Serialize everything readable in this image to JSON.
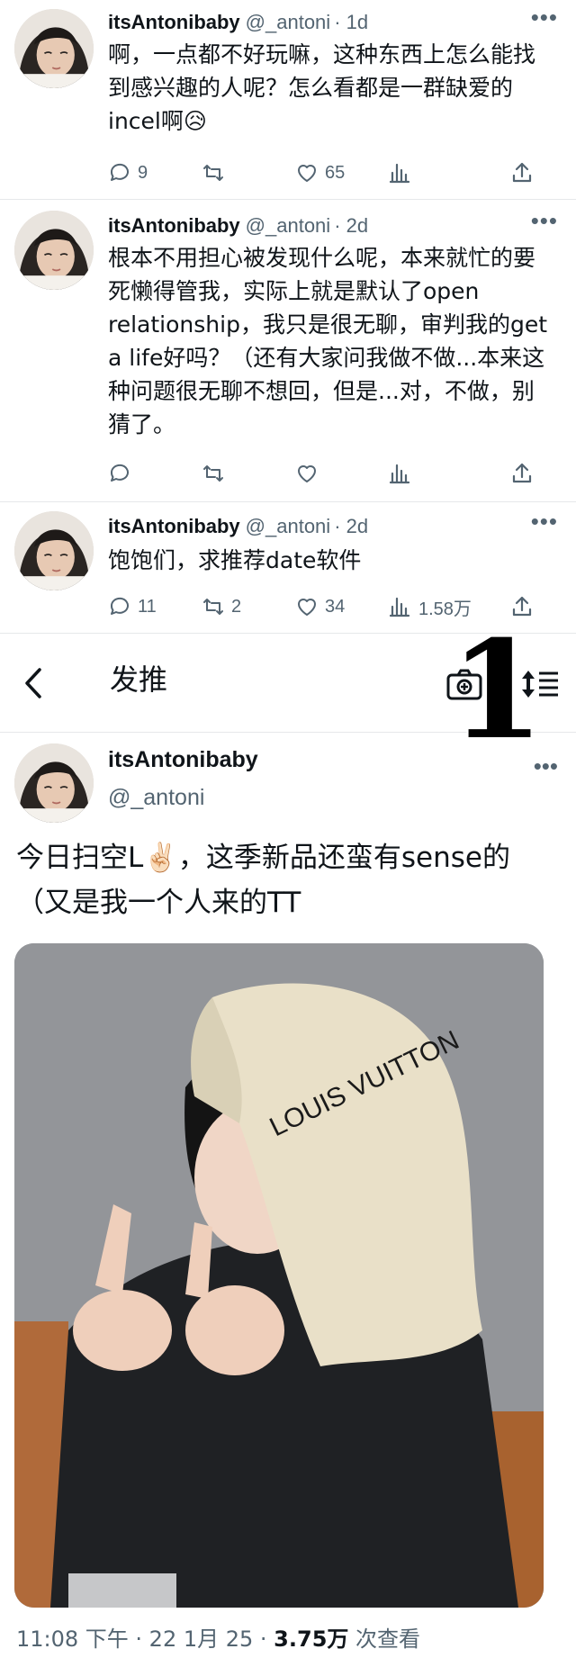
{
  "tweets": [
    {
      "name": "itsAntonibaby",
      "handle": "@_antoni",
      "time": "· 1d",
      "text": "啊，一点都不好玩嘛，这种东西上怎么能找到感兴趣的人呢？怎么看都是一群缺爱的incel啊😥",
      "replies": "9",
      "retweets": "",
      "likes": "65",
      "views": ""
    },
    {
      "name": "itsAntonibaby",
      "handle": "@_antoni",
      "time": "· 2d",
      "text": "根本不用担心被发现什么呢，本来就忙的要死懒得管我，实际上就是默认了open relationship，我只是很无聊，审判我的get a life好吗？（还有大家问我做不做...本来这种问题很无聊不想回，但是...对，不做，别猜了。",
      "replies": "",
      "retweets": "",
      "likes": "",
      "views": ""
    },
    {
      "name": "itsAntonibaby",
      "handle": "@_antoni",
      "time": "· 2d",
      "text": "饱饱们，求推荐date软件",
      "replies": "11",
      "retweets": "2",
      "likes": "34",
      "views": "1.58万"
    }
  ],
  "nav": {
    "title": "发推",
    "overlay_number": "1"
  },
  "main_tweet": {
    "name": "itsAntonibaby",
    "handle": "@_antoni",
    "text": "今日扫空L✌🏻，这季新品还蛮有sense的（又是我一个人来的TT",
    "photo_text": "LOUIS VUITTON",
    "time": "11:08 下午 · 22 1月 25 · ",
    "views": "3.75万",
    "views_label": " 次查看"
  },
  "colors": {
    "text": "#0f1419",
    "muted": "#536471",
    "divider": "#e6e8ea"
  },
  "icons": [
    "reply-icon",
    "retweet-icon",
    "like-icon",
    "views-icon",
    "share-icon",
    "back-icon",
    "camera-plus-icon",
    "sort-icon",
    "more-icon"
  ]
}
